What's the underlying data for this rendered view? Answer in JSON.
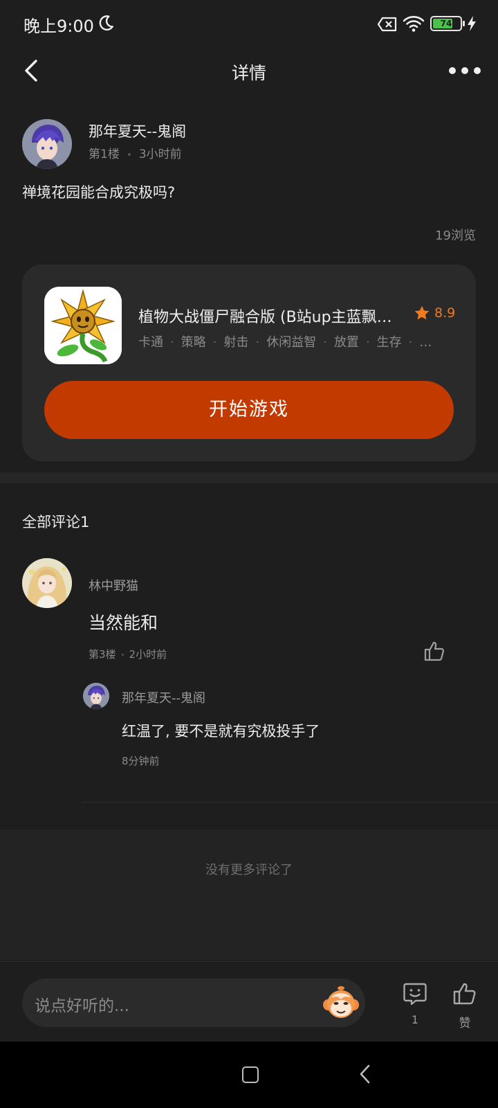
{
  "status_bar": {
    "time": "晚上9:00",
    "battery": "74",
    "battery_level": 0.74
  },
  "header": {
    "title": "详情"
  },
  "post": {
    "author": "那年夏天--鬼阁",
    "floor": "第1楼",
    "time": "3小时前",
    "content": "禅境花园能合成究极吗?",
    "views": "19浏览"
  },
  "game": {
    "title": "植物大战僵尸融合版 (B站up主蓝飘…",
    "rating": "8.9",
    "tags": [
      "卡通",
      "策略",
      "射击",
      "休闲益智",
      "放置",
      "生存",
      "…"
    ],
    "play_label": "开始游戏",
    "accent": "#c23a00"
  },
  "comments": {
    "title": "全部评论1",
    "items": [
      {
        "author": "林中野猫",
        "content": "当然能和",
        "floor": "第3楼",
        "time": "2小时前",
        "replies": [
          {
            "author": "那年夏天--鬼阁",
            "content": "红温了, 要不是就有究极投手了",
            "time": "8分钟前"
          }
        ]
      }
    ],
    "no_more": "没有更多评论了"
  },
  "bottom_bar": {
    "placeholder": "说点好听的...",
    "reply_count": "1",
    "like_label": "赞"
  },
  "icons": {
    "back": "chevron-left-icon",
    "more": "more-dots-icon",
    "star": "star-icon",
    "like": "thumbs-up-icon",
    "reply": "comment-smile-icon"
  }
}
